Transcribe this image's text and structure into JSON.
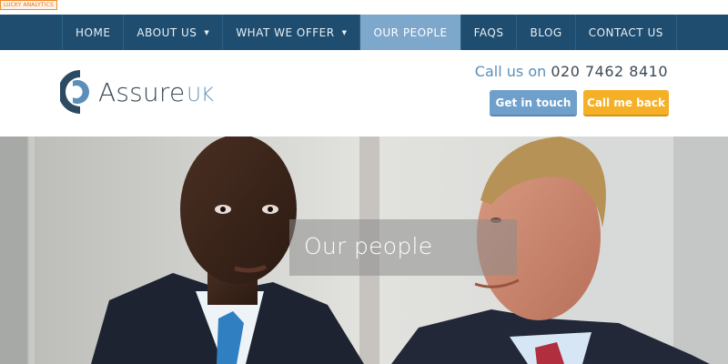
{
  "badge": {
    "text": "LUCKY ANALYTICS"
  },
  "nav": {
    "items": [
      {
        "label": "HOME",
        "has_dropdown": false,
        "active": false
      },
      {
        "label": "ABOUT US",
        "has_dropdown": true,
        "active": false
      },
      {
        "label": "WHAT WE OFFER",
        "has_dropdown": true,
        "active": false
      },
      {
        "label": "OUR PEOPLE",
        "has_dropdown": false,
        "active": true
      },
      {
        "label": "FAQS",
        "has_dropdown": false,
        "active": false
      },
      {
        "label": "BLOG",
        "has_dropdown": false,
        "active": false
      },
      {
        "label": "CONTACT US",
        "has_dropdown": false,
        "active": false
      }
    ],
    "caret": "▼"
  },
  "header": {
    "logo": {
      "name": "Assure",
      "suffix": "UK"
    },
    "callus_prefix": "Call us on",
    "phone": "020 7462 8410",
    "get_in_touch": "Get in touch",
    "call_me_back": "Call me back"
  },
  "hero": {
    "title": "Our people"
  },
  "colors": {
    "nav_bg": "#1e4d6f",
    "nav_active": "#7ea7cc",
    "accent_blue": "#6f9fcb",
    "accent_orange": "#f5b027"
  }
}
